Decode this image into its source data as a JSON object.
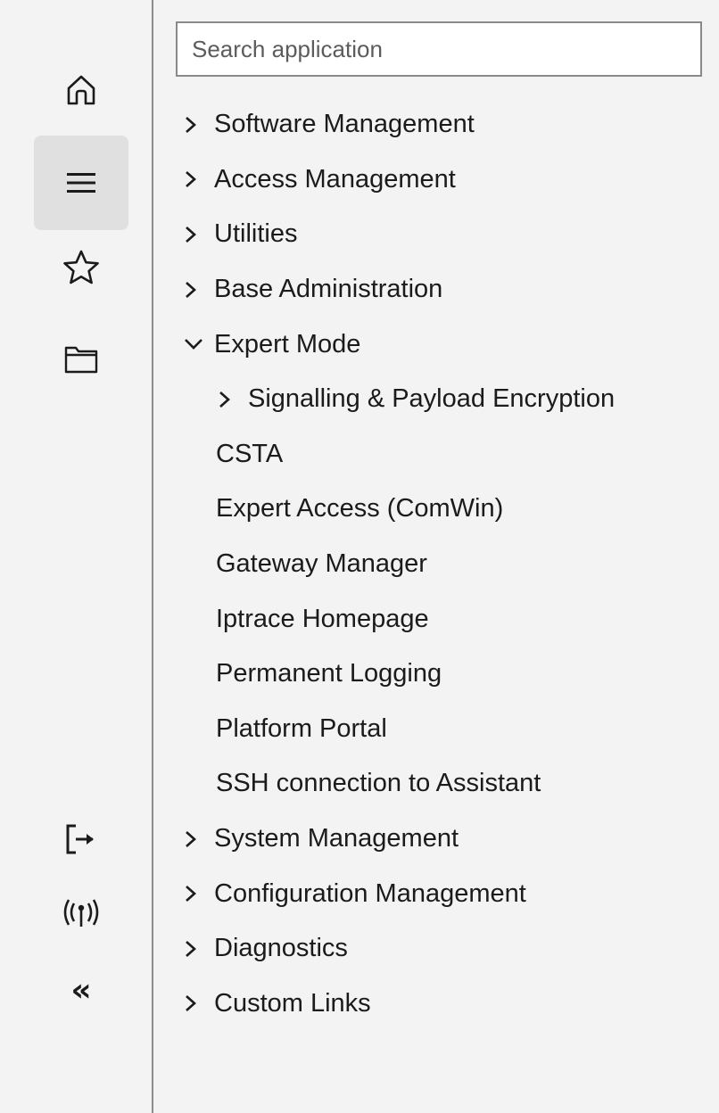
{
  "rail": {
    "top": [
      {
        "name": "home-icon",
        "label": "Home"
      },
      {
        "name": "menu-icon",
        "label": "Menu",
        "active": true
      },
      {
        "name": "star-icon",
        "label": "Favorites"
      },
      {
        "name": "folder-icon",
        "label": "Files"
      }
    ],
    "bottom": [
      {
        "name": "logout-icon",
        "label": "Logout"
      },
      {
        "name": "antenna-icon",
        "label": "Connection",
        "glyph": "((ı))"
      },
      {
        "name": "collapse-icon",
        "label": "Collapse",
        "glyph": "«"
      }
    ],
    "colors": {
      "active_bg": "#e0e0e0",
      "rail_border": "#8c8c8c"
    }
  },
  "search": {
    "placeholder": "Search application",
    "value": ""
  },
  "nav": {
    "items": [
      {
        "label": "Software Management",
        "expanded": false
      },
      {
        "label": "Access Management",
        "expanded": false
      },
      {
        "label": "Utilities",
        "expanded": false
      },
      {
        "label": "Base Administration",
        "expanded": false
      },
      {
        "label": "Expert Mode",
        "expanded": true
      },
      {
        "label": "Signalling & Payload Encryption",
        "expanded": false
      },
      {
        "label": "CSTA"
      },
      {
        "label": "Expert Access (ComWin)"
      },
      {
        "label": "Gateway Manager"
      },
      {
        "label": "Iptrace Homepage"
      },
      {
        "label": "Permanent Logging"
      },
      {
        "label": "Platform Portal"
      },
      {
        "label": "SSH connection to Assistant"
      },
      {
        "label": "System Management",
        "expanded": false
      },
      {
        "label": "Configuration Management",
        "expanded": false
      },
      {
        "label": "Diagnostics",
        "expanded": false
      },
      {
        "label": "Custom Links",
        "expanded": false
      }
    ]
  }
}
